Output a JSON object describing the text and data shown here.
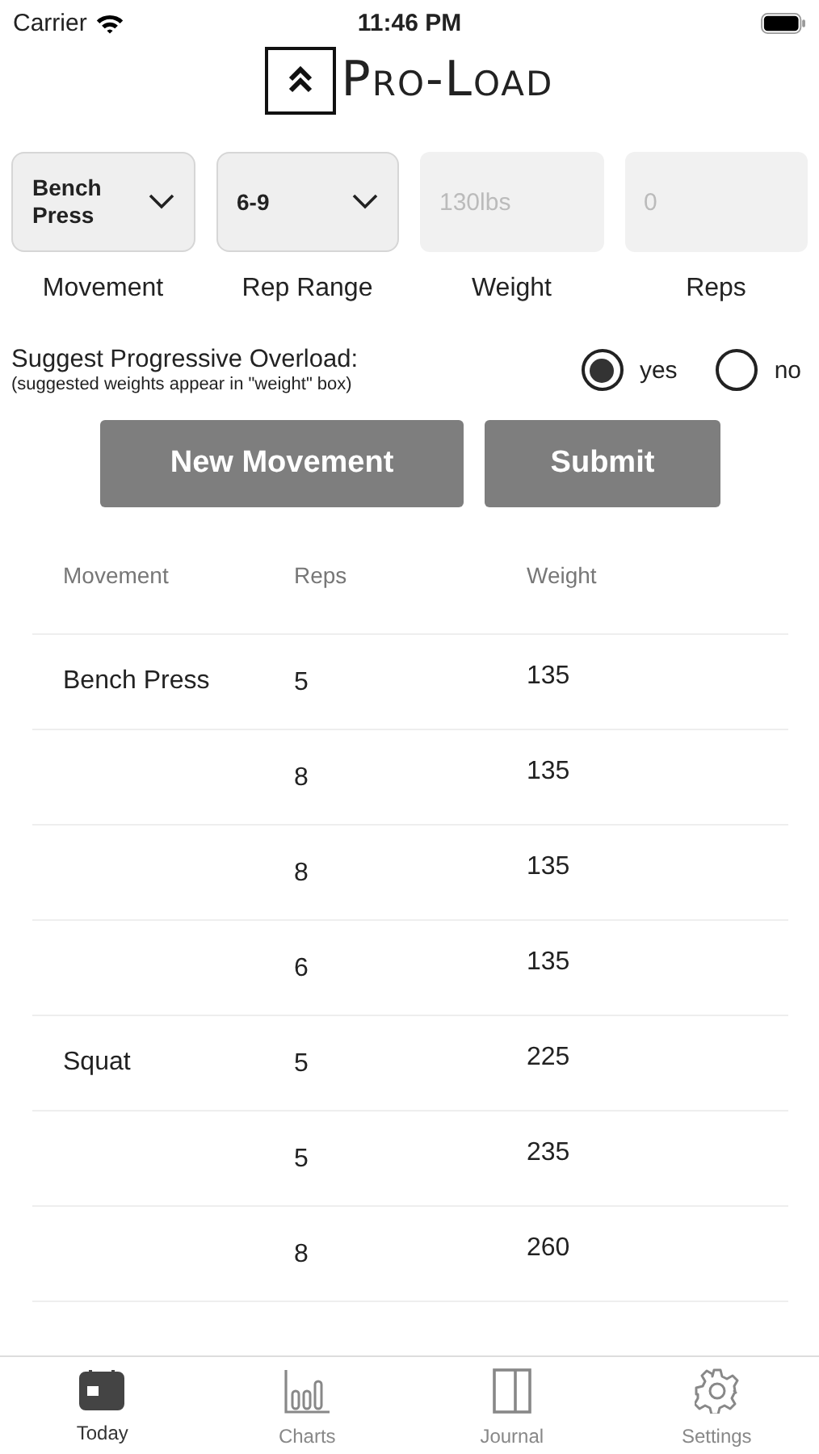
{
  "status_bar": {
    "carrier": "Carrier",
    "time": "11:46 PM"
  },
  "logo": {
    "text": "Pro-Load"
  },
  "inputs": [
    {
      "kind": "dropdown",
      "value": "Bench Press",
      "label": "Movement"
    },
    {
      "kind": "dropdown",
      "value": "6-9",
      "label": "Rep Range"
    },
    {
      "kind": "field",
      "placeholder": "130lbs",
      "label": "Weight"
    },
    {
      "kind": "field",
      "placeholder": "0",
      "label": "Reps"
    }
  ],
  "overload": {
    "title": "Suggest Progressive Overload:",
    "note": "(suggested weights appear in \"weight\" box)",
    "options": [
      {
        "label": "yes",
        "selected": true
      },
      {
        "label": "no",
        "selected": false
      }
    ]
  },
  "buttons": [
    "New Movement",
    "Submit"
  ],
  "table": {
    "columns": [
      "Movement",
      "Reps",
      "Weight"
    ],
    "rows": [
      {
        "movement": "Bench Press",
        "reps": "5",
        "weight": "135"
      },
      {
        "reps": "8",
        "weight": "135"
      },
      {
        "reps": "8",
        "weight": "135"
      },
      {
        "reps": "6",
        "weight": "135"
      },
      {
        "movement": "Squat",
        "reps": "5",
        "weight": "225"
      },
      {
        "reps": "5",
        "weight": "235"
      },
      {
        "reps": "8",
        "weight": "260"
      }
    ]
  },
  "tab_bar": [
    {
      "label": "Today",
      "kind": "calendar",
      "selected": true
    },
    {
      "label": "Charts",
      "kind": "chart",
      "selected": false
    },
    {
      "label": "Journal",
      "kind": "book",
      "selected": false
    },
    {
      "label": "Settings",
      "kind": "gear",
      "selected": false
    }
  ]
}
